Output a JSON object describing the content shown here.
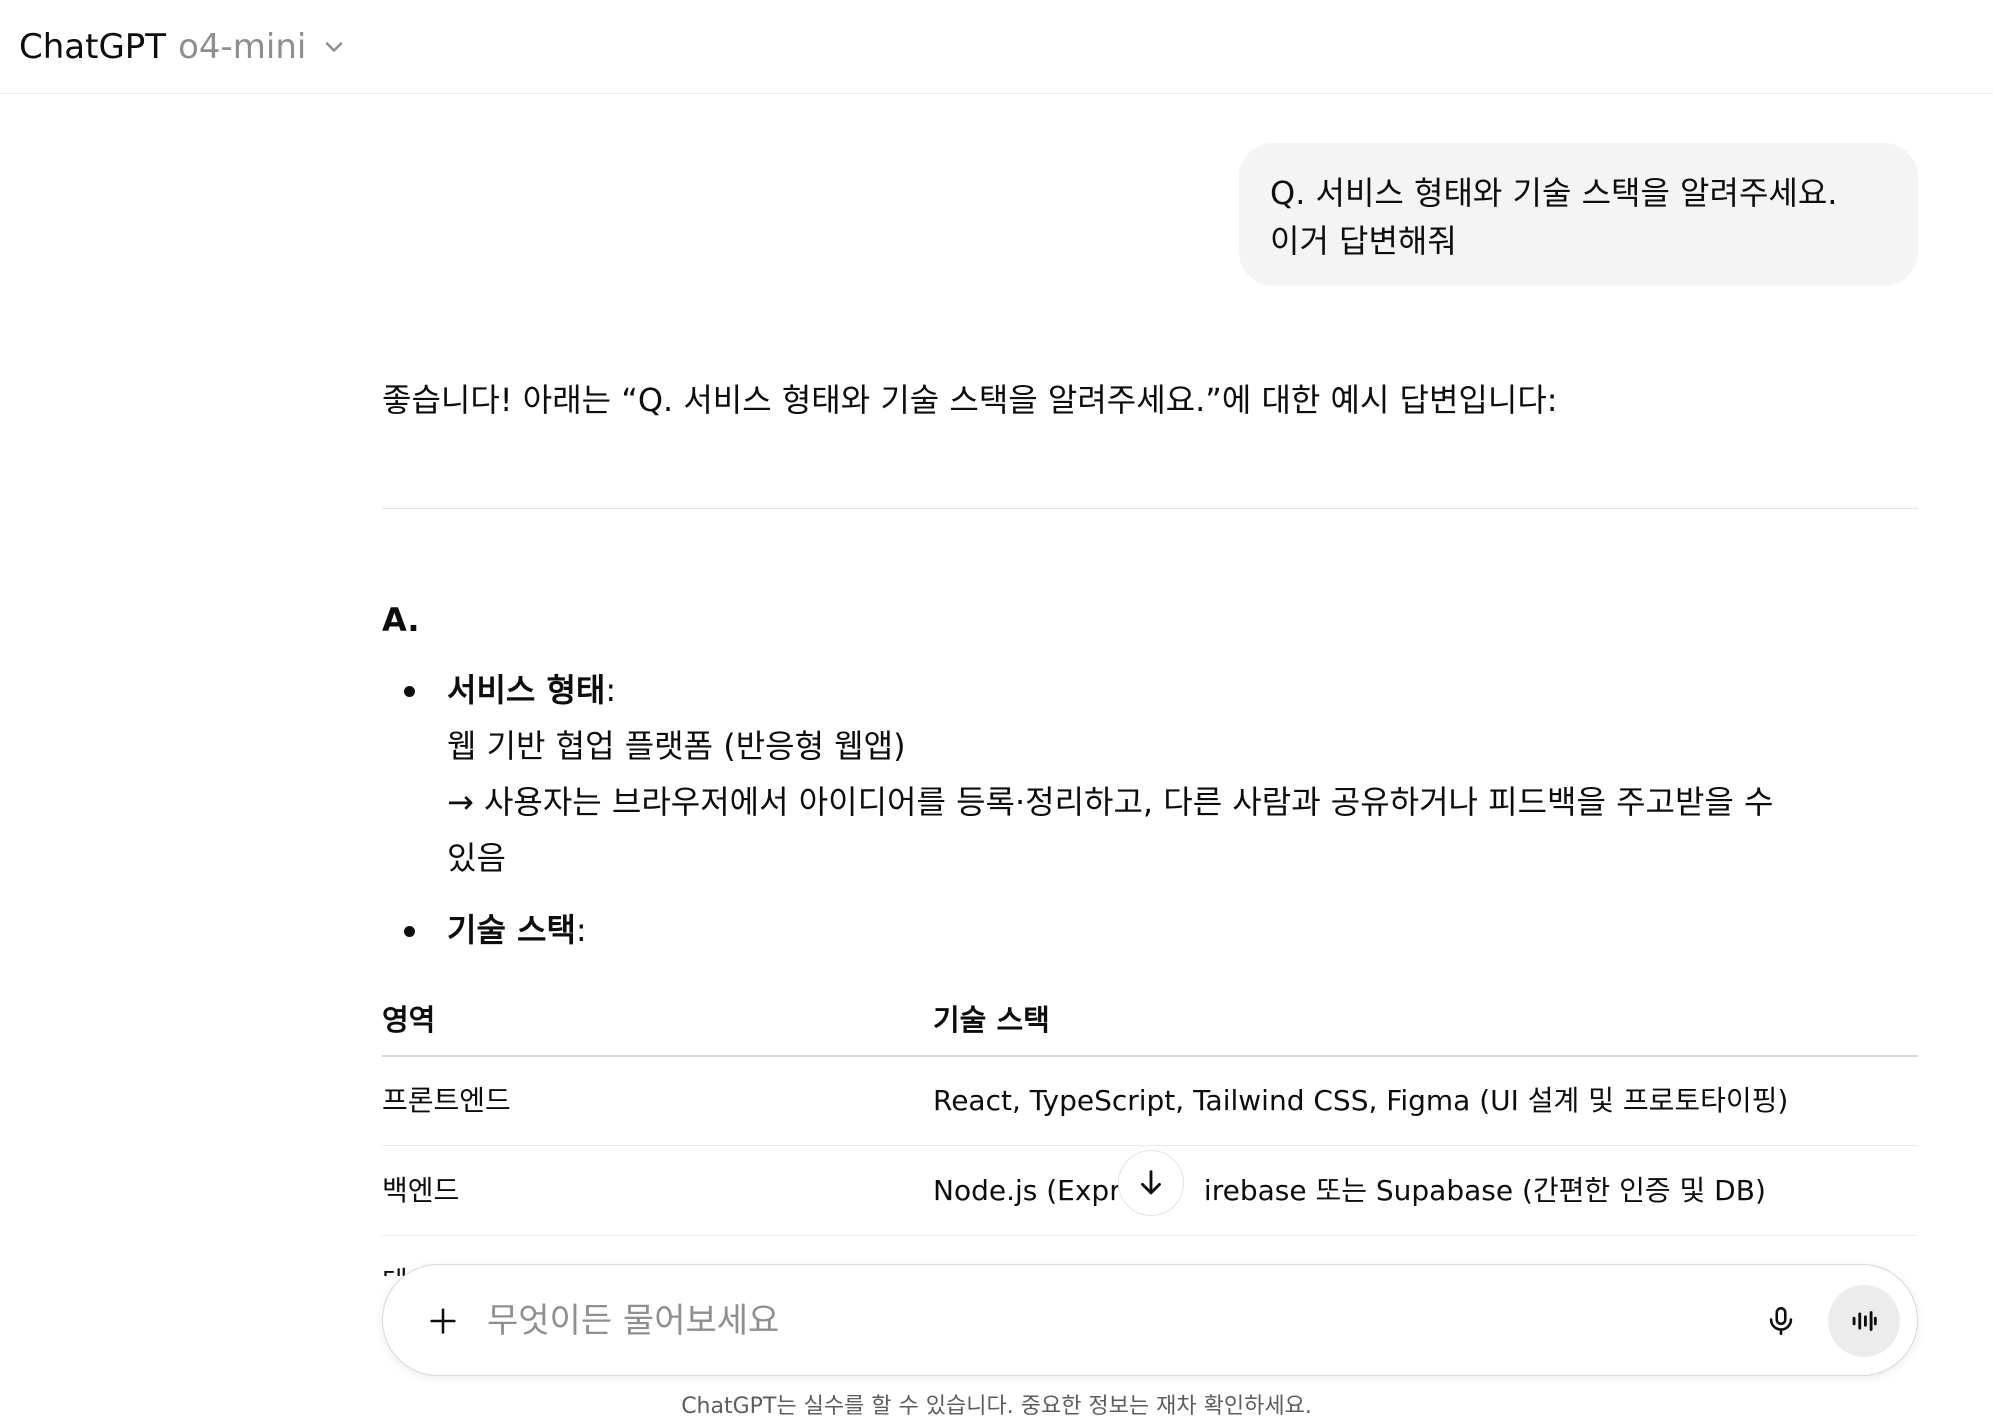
{
  "header": {
    "app_name": "ChatGPT",
    "model_name": "o4-mini"
  },
  "user_message": {
    "line1": "Q. 서비스 형태와 기술 스택을 알려주세요.",
    "line2": "이거 답변해줘"
  },
  "assistant": {
    "intro": "좋습니다! 아래는 “Q. 서비스 형태와 기술 스택을 알려주세요.”에 대한 예시 답변입니다:",
    "answer_label": "A.",
    "service": {
      "title": "서비스 형태",
      "suffix": ":",
      "line1": "웹 기반 협업 플랫폼 (반응형 웹앱)",
      "line2": "→ 사용자는 브라우저에서 아이디어를 등록·정리하고, 다른 사람과 공유하거나 피드백을 주고받을 수",
      "line3": "있음"
    },
    "tech": {
      "title": "기술 스택",
      "suffix": ":"
    },
    "table": {
      "headers": [
        "영역",
        "기술 스택"
      ],
      "rows": [
        [
          "프론트엔드",
          "React, TypeScript, Tailwind CSS, Figma (UI 설계 및 프로토타이핑)"
        ],
        [
          "백엔드",
          "Node.js (Expres",
          "irebase 또는 Supabase (간편한 인증 및 DB)"
        ]
      ],
      "row3_peek": "데"
    }
  },
  "composer": {
    "placeholder": "무엇이든 물어보세요"
  },
  "disclaimer": "ChatGPT는 실수를 할 수 있습니다. 중요한 정보는 재차 확인하세요.",
  "icons": {
    "model_dropdown": "chevron-down-icon",
    "scroll_down": "arrow-down-icon",
    "attach": "plus-icon",
    "dictate": "microphone-icon",
    "voice": "voice-waveform-icon"
  }
}
